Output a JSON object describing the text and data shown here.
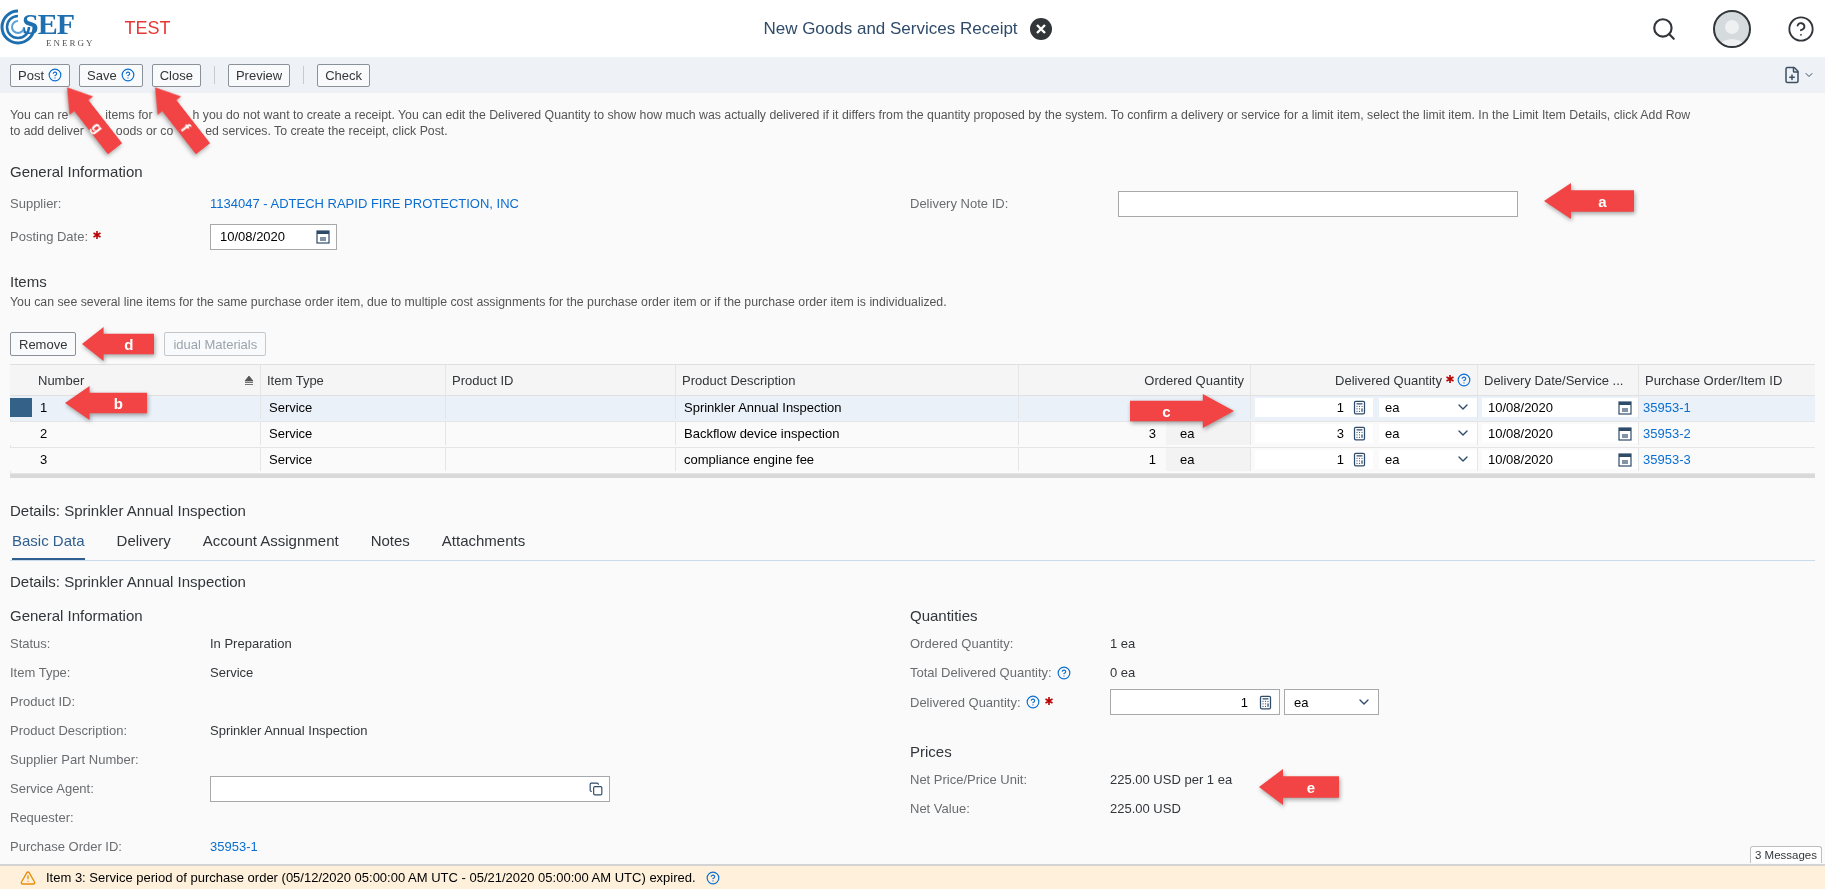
{
  "header": {
    "brand": "SEF",
    "brand_tagline": "ENERGY",
    "environment": "TEST",
    "title": "New Goods and Services Receipt"
  },
  "toolbar": [
    {
      "kind": "button",
      "label": "Post",
      "help": true
    },
    {
      "kind": "button",
      "label": "Save",
      "help": true
    },
    {
      "kind": "button",
      "label": "Close"
    },
    {
      "kind": "separator"
    },
    {
      "kind": "button",
      "label": "Preview"
    },
    {
      "kind": "separator"
    },
    {
      "kind": "button",
      "label": "Check"
    }
  ],
  "instructions": [
    [
      "You can re",
      "items for",
      "h you do not want to create a receipt. You can edit the Delivered Quantity to show how much was actually delivered if it differs from the quantity proposed by the system. To confirm a delivery or service for a limit item, select the limit item. In the Limit Item Details, click Add Row"
    ],
    [
      "to add deliver",
      "oods or co",
      "ed services. To create the receipt, click Post."
    ]
  ],
  "general_information": {
    "heading": "General Information",
    "supplier": {
      "label": "Supplier:",
      "value": "1134047 - ADTECH RAPID FIRE PROTECTION, INC"
    },
    "posting_date": {
      "label": "Posting Date:",
      "value": "10/08/2020",
      "required": true
    },
    "delivery_note_id": {
      "label": "Delivery Note ID:"
    }
  },
  "items": {
    "heading": "Items",
    "description": "You can see several line items for the same purchase order item, due to multiple cost assignments for the purchase order item or if the purchase order item is individualized.",
    "actions": [
      {
        "label": "Remove",
        "disabled": false
      },
      {
        "label": "idual Materials",
        "disabled": true
      }
    ],
    "columns": [
      {
        "label": "Number",
        "sortable": true
      },
      {
        "label": "Item Type"
      },
      {
        "label": "Product ID"
      },
      {
        "label": "Product Description"
      },
      {
        "label": "Ordered Quantity"
      },
      {
        "label": "Delivered Quantity",
        "required": true,
        "help": true
      },
      {
        "label": "Delivery Date/Service ..."
      },
      {
        "label": "Purchase Order/Item ID"
      }
    ],
    "rows": [
      {
        "selected": true,
        "number": "1",
        "item_type": "Service",
        "product_description": "Sprinkler Annual Inspection",
        "delivered_quantity": "1",
        "delivered_unit": "ea",
        "delivery_date": "10/08/2020",
        "po_item_id": "35953-1"
      },
      {
        "selected": false,
        "number": "2",
        "item_type": "Service",
        "product_description": "Backflow device inspection",
        "ordered_quantity": "3",
        "ordered_unit": "ea",
        "delivered_quantity": "3",
        "delivered_unit": "ea",
        "delivery_date": "10/08/2020",
        "po_item_id": "35953-2"
      },
      {
        "selected": false,
        "number": "3",
        "item_type": "Service",
        "product_description": "compliance engine fee",
        "ordered_quantity": "1",
        "ordered_unit": "ea",
        "delivered_quantity": "1",
        "delivered_unit": "ea",
        "delivery_date": "10/08/2020",
        "po_item_id": "35953-3"
      }
    ]
  },
  "details": {
    "title": "Details: Sprinkler Annual Inspection",
    "tabs": [
      {
        "label": "Basic Data",
        "selected": true
      },
      {
        "label": "Delivery",
        "selected": false
      },
      {
        "label": "Account Assignment",
        "selected": false
      },
      {
        "label": "Notes",
        "selected": false
      },
      {
        "label": "Attachments",
        "selected": false
      }
    ],
    "subtitle": "Details: Sprinkler Annual Inspection",
    "general_information": {
      "heading": "General Information",
      "fields": [
        {
          "kind": "text",
          "label": "Status:",
          "value": "In Preparation"
        },
        {
          "kind": "text",
          "label": "Item Type:",
          "value": "Service"
        },
        {
          "kind": "text",
          "label": "Product ID:"
        },
        {
          "kind": "text",
          "label": "Product Description:",
          "value": "Sprinkler Annual Inspection"
        },
        {
          "kind": "text",
          "label": "Supplier Part Number:"
        },
        {
          "kind": "value_help",
          "label": "Service Agent:"
        },
        {
          "kind": "text",
          "label": "Requester:"
        },
        {
          "kind": "link",
          "label": "Purchase Order ID:",
          "value": "35953-1"
        }
      ]
    },
    "quantities": {
      "heading": "Quantities",
      "fields": [
        {
          "kind": "text",
          "label": "Ordered Quantity:",
          "value": "1 ea"
        },
        {
          "kind": "text",
          "label": "Total Delivered Quantity:",
          "value": "0 ea",
          "help": true
        },
        {
          "kind": "quantity",
          "label": "Delivered Quantity:",
          "value": "1",
          "unit": "ea",
          "help": true,
          "required": true
        }
      ]
    },
    "prices": {
      "heading": "Prices",
      "fields": [
        {
          "kind": "text",
          "label": "Net Price/Price Unit:",
          "value": "225.00 USD per 1 ea"
        },
        {
          "kind": "text",
          "label": "Net Value:",
          "value": "225.00 USD"
        }
      ]
    }
  },
  "messages": {
    "count_label": "3 Messages",
    "items": [
      {
        "kind": "warning",
        "text": "Item 3: Service period of purchase order (05/12/2020 05:00:00 AM UTC - 05/21/2020 05:00:00 AM UTC) expired."
      }
    ]
  },
  "callouts": [
    {
      "letter": "a"
    },
    {
      "letter": "b"
    },
    {
      "letter": "c"
    },
    {
      "letter": "d"
    },
    {
      "letter": "e"
    },
    {
      "letter": "f"
    },
    {
      "letter": "g"
    }
  ]
}
